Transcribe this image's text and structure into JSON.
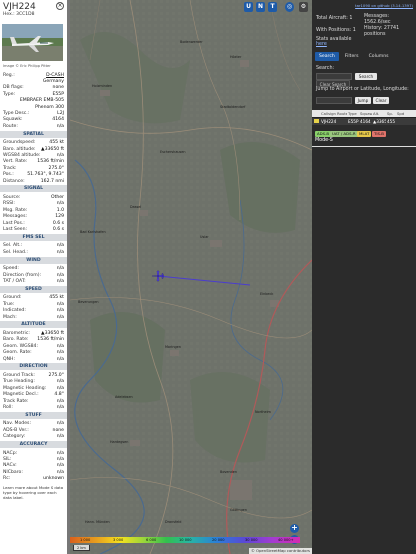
{
  "detail": {
    "callsign": "VJH224",
    "hex": "Hex.: 3CC1D8",
    "photo_credit": "Image © Eric Philipp Pitter",
    "info": [
      {
        "k": "Reg.:",
        "v": "D-CASH",
        "link": true
      },
      {
        "k": "",
        "v": "Germany"
      },
      {
        "k": "DB flags:",
        "v": "none"
      },
      {
        "k": "Type:",
        "v": "E55P"
      },
      {
        "k": "",
        "v": "EMBRAER EMB-505"
      },
      {
        "k": "",
        "v": "Phenom 300"
      },
      {
        "k": "Type Desc.:",
        "v": "L2J"
      },
      {
        "k": "Squawk:",
        "v": "4164"
      },
      {
        "k": "Route:",
        "v": "n/a"
      }
    ],
    "spatial_title": "SPATIAL",
    "spatial": [
      {
        "k": "Groundspeed:",
        "v": "455 kt"
      },
      {
        "k": "Baro. altitude:",
        "v": "▲33650 ft"
      },
      {
        "k": "WGS84 altitude:",
        "v": "n/a"
      },
      {
        "k": "Vert. Rate:",
        "v": "1536 ft/min"
      },
      {
        "k": "Track:",
        "v": "275.0°"
      },
      {
        "k": "Pos.:",
        "v": "51.763°, 9.743°"
      },
      {
        "k": "Distance:",
        "v": "162.7 nmi"
      }
    ],
    "signal_title": "SIGNAL",
    "signal": [
      {
        "k": "Source:",
        "v": "Other"
      },
      {
        "k": "RSSI:",
        "v": "n/a"
      },
      {
        "k": "Msg. Rate:",
        "v": "1.0"
      },
      {
        "k": "Messages:",
        "v": "129"
      },
      {
        "k": "Last Pos.:",
        "v": "0.6 s"
      },
      {
        "k": "Last Seen:",
        "v": "0.6 s"
      }
    ],
    "fms_title": "FMS SEL",
    "fms": [
      {
        "k": "Sel. Alt.:",
        "v": "n/a"
      },
      {
        "k": "Sel. Head.:",
        "v": "n/a"
      }
    ],
    "wind_title": "WIND",
    "wind": [
      {
        "k": "Speed:",
        "v": "n/a"
      },
      {
        "k": "Direction (from):",
        "v": "n/a"
      },
      {
        "k": "TAT / OAT:",
        "v": "n/a"
      }
    ],
    "speed_title": "SPEED",
    "speed": [
      {
        "k": "Ground:",
        "v": "455 kt"
      },
      {
        "k": "True:",
        "v": "n/a"
      },
      {
        "k": "Indicated:",
        "v": "n/a"
      },
      {
        "k": "Mach:",
        "v": "n/a"
      }
    ],
    "altitude_title": "ALTITUDE",
    "altitude": [
      {
        "k": "Barometric:",
        "v": "▲33650 ft"
      },
      {
        "k": "Baro. Rate:",
        "v": "1536 ft/min"
      },
      {
        "k": "Geom. WGS84:",
        "v": "n/a"
      },
      {
        "k": "Geom. Rate:",
        "v": "n/a"
      },
      {
        "k": "QNH:",
        "v": "n/a"
      }
    ],
    "direction_title": "DIRECTION",
    "direction": [
      {
        "k": "Ground Track:",
        "v": "275.0°"
      },
      {
        "k": "True Heading:",
        "v": "n/a"
      },
      {
        "k": "Magnetic Heading:",
        "v": "n/a"
      },
      {
        "k": "Magnetic Decl.:",
        "v": "4.8°"
      },
      {
        "k": "Track Rate:",
        "v": "n/a"
      },
      {
        "k": "Roll:",
        "v": "n/a"
      }
    ],
    "stuff_title": "STUFF",
    "stuff": [
      {
        "k": "Nav. Modes:",
        "v": "n/a"
      },
      {
        "k": "ADS-B Ver.:",
        "v": "none"
      },
      {
        "k": "Category:",
        "v": "n/a"
      }
    ],
    "accuracy_title": "ACCURACY",
    "accuracy": [
      {
        "k": "NACp:",
        "v": "n/a"
      },
      {
        "k": "SIL:",
        "v": "n/a"
      },
      {
        "k": "NACv:",
        "v": "n/a"
      },
      {
        "k": "NICbaro:",
        "v": "n/a"
      },
      {
        "k": "Rc:",
        "v": "unknown"
      }
    ],
    "footer_note": "Learn more about Mode S data type by hovering over each data label."
  },
  "map": {
    "top_buttons": [
      "U",
      "N",
      "T"
    ],
    "side_buttons": [
      "L",
      "O",
      "K",
      "M",
      "P",
      "I",
      "R",
      "F"
    ],
    "legend_labels": [
      "1 000",
      "3 000",
      "6 000",
      "10 000",
      "20 000",
      "30 000",
      "40 000+"
    ],
    "scale": "2 km",
    "attribution": "© OpenStreetMap contributors",
    "places": [
      "Holzminden",
      "Höxter",
      "Bodenwerder",
      "Uslar",
      "Dassel",
      "Einbeck",
      "Moringen",
      "Northeim",
      "Hardegsen",
      "Bovenden",
      "Göttingen",
      "Dransfeld",
      "Adelebsen",
      "Hann. Münden",
      "Bad Karlshafen",
      "Beverungen",
      "Stadtoldendorf",
      "Eschershausen"
    ],
    "colors": {
      "track": "#4a3ccf",
      "plane": "#5a4be0",
      "button": "#1e5ba8"
    }
  },
  "panel": {
    "version": "tar1090 on github (3.14.1397)",
    "total_aircraft": "Total Aircraft: 1",
    "with_positions": "With Positions: 1",
    "messages": "Messages: 1562.6/sec",
    "history": "History: 27741 positions",
    "stats_label": "Stats available",
    "stats_link": "here",
    "tabs": [
      "Search",
      "Filters",
      "Columns"
    ],
    "search_label": "Search:",
    "search_button": "Search",
    "clear_search": "Clear Search",
    "jump_label": "Jump to Airport or Latitude, Longitude:",
    "jump_button": "Jump",
    "clear_button": "Clear",
    "columns": [
      "",
      "Callsign",
      "Route",
      "Type",
      "Squawk",
      "Alt.",
      "Sp.",
      "Spd"
    ],
    "rows": [
      [
        "",
        "VJH224",
        "",
        "E55P",
        "4164",
        "▲33650",
        "455",
        ""
      ]
    ],
    "sources": [
      {
        "label": "ADS-B",
        "color": "#8ad16a"
      },
      {
        "label": "UAT / ADS-R",
        "color": "#9ac77e"
      },
      {
        "label": "MLAT",
        "color": "#e6c84a"
      },
      {
        "label": "TIS-B",
        "color": "#e0736a"
      }
    ],
    "mode_s": "Mode-S"
  }
}
